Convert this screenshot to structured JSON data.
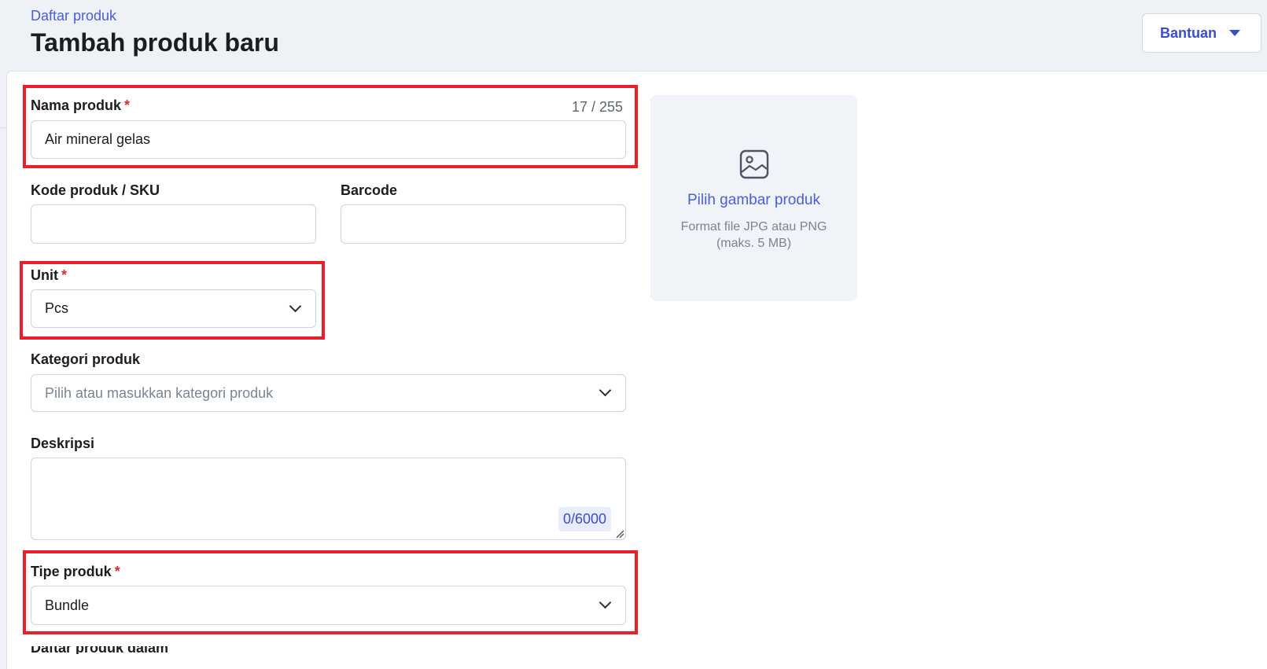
{
  "header": {
    "breadcrumb": "Daftar produk",
    "title": "Tambah produk baru",
    "help_button": "Bantuan"
  },
  "form": {
    "name": {
      "label": "Nama produk",
      "required_mark": "*",
      "value": "Air mineral gelas",
      "counter": "17 / 255"
    },
    "sku": {
      "label": "Kode produk / SKU",
      "value": ""
    },
    "barcode": {
      "label": "Barcode",
      "value": ""
    },
    "unit": {
      "label": "Unit",
      "required_mark": "*",
      "value": "Pcs"
    },
    "category": {
      "label": "Kategori produk",
      "placeholder": "Pilih atau masukkan kategori produk"
    },
    "description": {
      "label": "Deskripsi",
      "value": "",
      "counter": "0/6000"
    },
    "type": {
      "label": "Tipe produk",
      "required_mark": "*",
      "value": "Bundle"
    },
    "next_label_partial": "Daftar produk dalam bundle"
  },
  "image_upload": {
    "title": "Pilih gambar produk",
    "hint_line1": "Format file JPG atau PNG",
    "hint_line2": "(maks. 5 MB)",
    "icon": "image-icon"
  },
  "colors": {
    "accent": "#4a5fd4",
    "highlight": "#e8202a",
    "required": "#d62e2e"
  }
}
